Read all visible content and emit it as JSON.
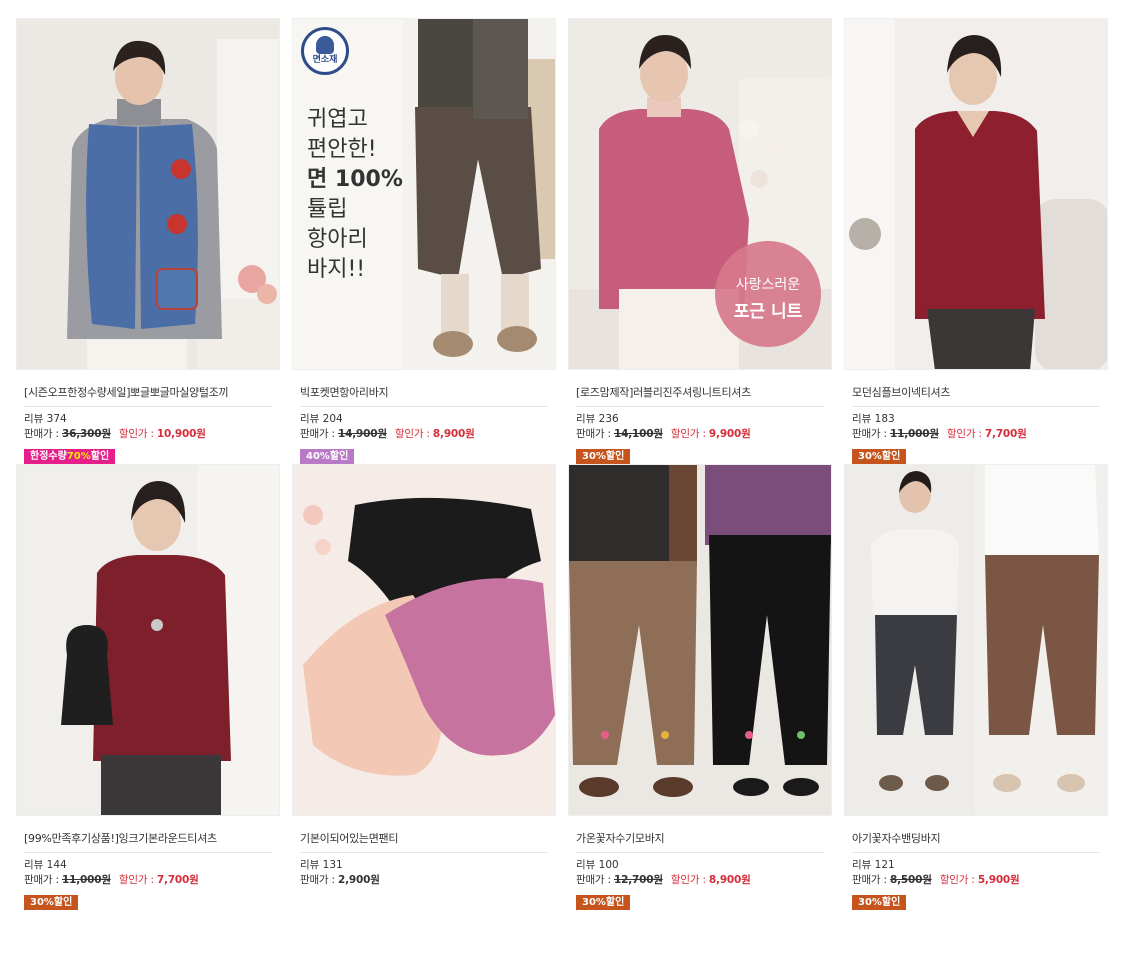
{
  "colors": {
    "sale_red": "#d62d3a",
    "badge_orange": "#c5541d",
    "badge_purple": "#b879c6",
    "badge_magenta": "#e41f8a",
    "badge_yellow": "#ffe400"
  },
  "labels": {
    "review": "리뷰",
    "price": "판매가 :",
    "sale_price": "할인가 :"
  },
  "products": [
    {
      "name": "[시즌오프한정수량세일]뽀글뽀글마실양털조끼",
      "reviews": "374",
      "orig_price": "36,300원",
      "sale_price": "10,900원",
      "badge_pre": "한정수량",
      "badge_highlight": "70%",
      "badge_post": "할인",
      "image_icon": "woman-blue-floral-vest-photo"
    },
    {
      "name": "빅포켓면항아리바지",
      "reviews": "204",
      "orig_price": "14,900원",
      "sale_price": "8,900원",
      "badge": "40%할인",
      "image_icon": "brown-balloon-pants-photo",
      "overlay": {
        "logo": "면소재",
        "lines": [
          "귀엽고",
          "편안한!",
          "면 100%",
          "튤립",
          "항아리",
          "바지!!"
        ]
      }
    },
    {
      "name": "[로즈맘제작]러블리진주셔링니트티셔츠",
      "reviews": "236",
      "orig_price": "14,100원",
      "sale_price": "9,900원",
      "badge": "30%할인",
      "image_icon": "woman-pink-knit-photo",
      "overlay": {
        "line1": "사랑스러운",
        "line2": "포근 니트"
      }
    },
    {
      "name": "모던심플브이넥티셔츠",
      "reviews": "183",
      "orig_price": "11,000원",
      "sale_price": "7,700원",
      "badge": "30%할인",
      "image_icon": "woman-burgundy-vneck-photo"
    },
    {
      "name": "[99%만족후기상품!]잉크기본라운드티셔츠",
      "reviews": "144",
      "orig_price": "11,000원",
      "sale_price": "7,700원",
      "badge": "30%할인",
      "image_icon": "woman-burgundy-round-tee-photo"
    },
    {
      "name": "기본이되어있는면팬티",
      "reviews": "131",
      "price": "2,900원",
      "image_icon": "cotton-panties-photo"
    },
    {
      "name": "가온꽃자수기모바지",
      "reviews": "100",
      "orig_price": "12,700원",
      "sale_price": "8,900원",
      "badge": "30%할인",
      "image_icon": "embroidered-fleece-pants-photo"
    },
    {
      "name": "아기꽃자수밴딩바지",
      "reviews": "121",
      "orig_price": "8,500원",
      "sale_price": "5,900원",
      "badge": "30%할인",
      "image_icon": "embroidered-band-pants-photo"
    }
  ]
}
